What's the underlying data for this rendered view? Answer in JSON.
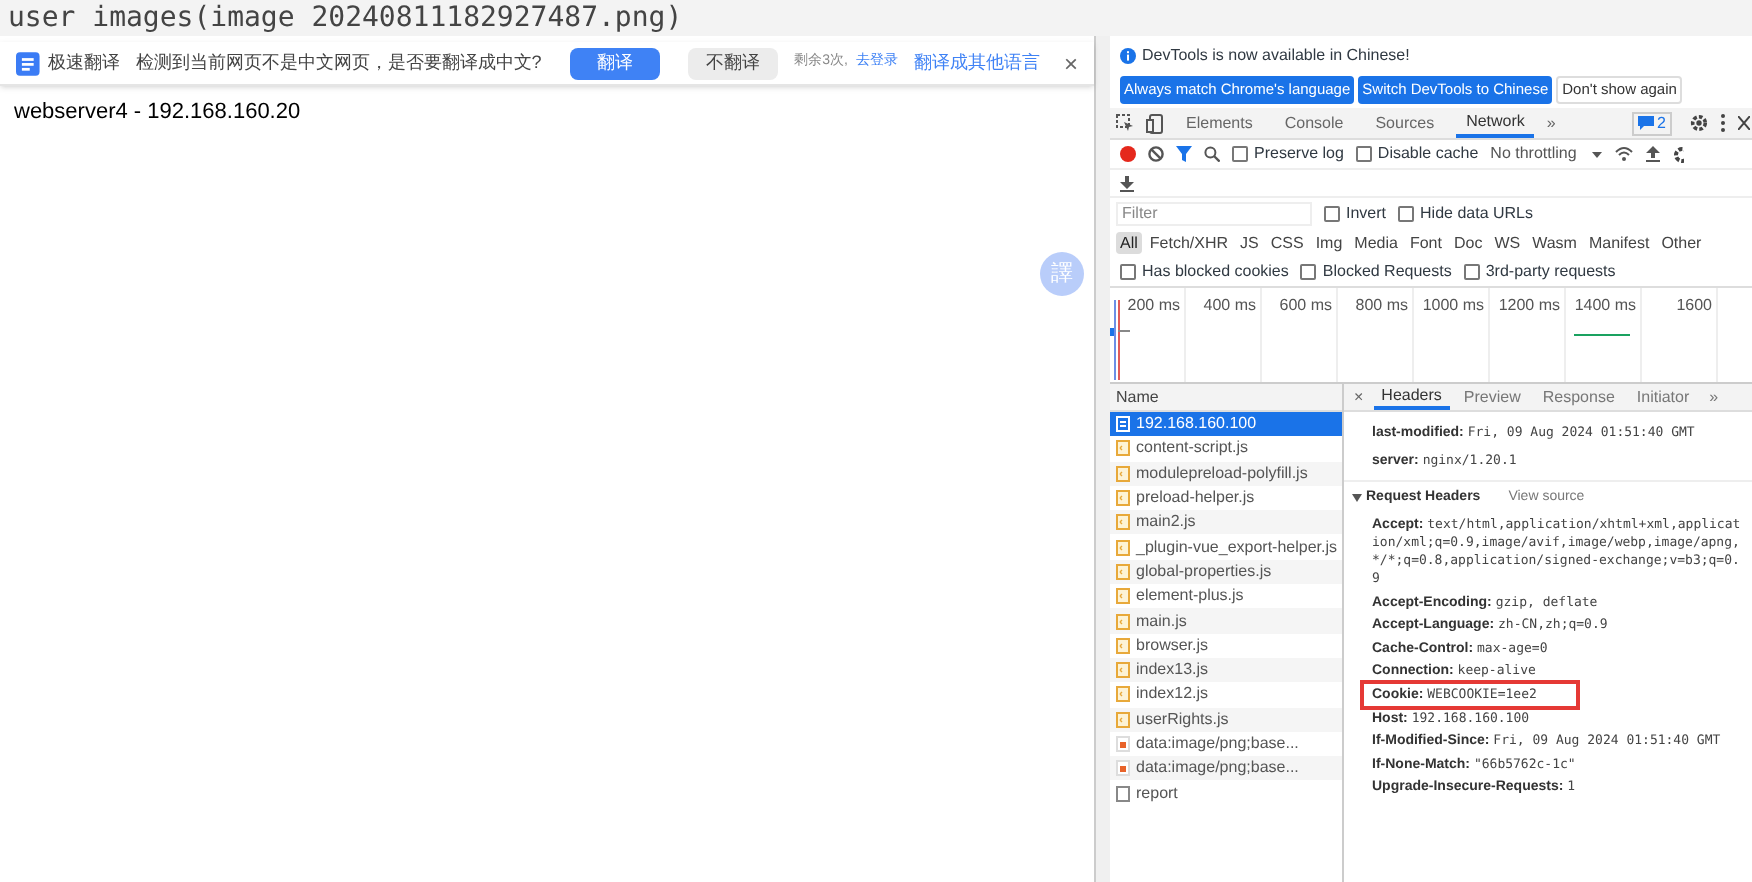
{
  "caption": "user images(image 20240811182927487.png)",
  "translate_bar": {
    "brand": "极速翻译",
    "message": "检测到当前网页不是中文网页，是否要翻译成中文?",
    "buttons": [
      {
        "label": "翻译",
        "primary": true
      },
      {
        "label": "不翻译",
        "primary": false
      }
    ],
    "remaining": "剩余3次,",
    "login": "去登录",
    "other_languages": "翻译成其他语言",
    "close": "×"
  },
  "page": {
    "text": "webserver4 - 192.168.160.20",
    "float_button": "譯"
  },
  "devtools": {
    "notice": {
      "message": "DevTools is now available in Chinese!",
      "buttons": [
        {
          "label": "Always match Chrome's language",
          "primary": true
        },
        {
          "label": "Switch DevTools to Chinese",
          "primary": true
        },
        {
          "label": "Don't show again",
          "primary": false
        }
      ]
    },
    "tabs": [
      {
        "label": "Elements",
        "selected": false
      },
      {
        "label": "Console",
        "selected": false
      },
      {
        "label": "Sources",
        "selected": false
      },
      {
        "label": "Network",
        "selected": true
      }
    ],
    "more_tabs": "»",
    "issues_count": "2",
    "toolbar": {
      "preserve_log": {
        "label": "Preserve log",
        "checked": false
      },
      "disable_cache": {
        "label": "Disable cache",
        "checked": false
      },
      "throttling": "No throttling"
    },
    "filter": {
      "placeholder": "Filter",
      "invert": {
        "label": "Invert",
        "checked": false
      },
      "hide_data_urls": {
        "label": "Hide data URLs",
        "checked": false
      }
    },
    "types": [
      {
        "label": "All",
        "selected": true
      },
      {
        "label": "Fetch/XHR",
        "selected": false
      },
      {
        "label": "JS",
        "selected": false
      },
      {
        "label": "CSS",
        "selected": false
      },
      {
        "label": "Img",
        "selected": false
      },
      {
        "label": "Media",
        "selected": false
      },
      {
        "label": "Font",
        "selected": false
      },
      {
        "label": "Doc",
        "selected": false
      },
      {
        "label": "WS",
        "selected": false
      },
      {
        "label": "Wasm",
        "selected": false
      },
      {
        "label": "Manifest",
        "selected": false
      },
      {
        "label": "Other",
        "selected": false
      }
    ],
    "blocked": [
      {
        "label": "Has blocked cookies",
        "checked": false
      },
      {
        "label": "Blocked Requests",
        "checked": false
      },
      {
        "label": "3rd-party requests",
        "checked": false
      }
    ],
    "timeline_ticks": [
      "200 ms",
      "400 ms",
      "600 ms",
      "800 ms",
      "1000 ms",
      "1200 ms",
      "1400 ms",
      "1600"
    ],
    "requests": {
      "header": "Name",
      "rows": [
        {
          "name": "192.168.160.100",
          "kind": "doc",
          "selected": true
        },
        {
          "name": "content-script.js",
          "kind": "script",
          "selected": false
        },
        {
          "name": "modulepreload-polyfill.js",
          "kind": "script",
          "selected": false
        },
        {
          "name": "preload-helper.js",
          "kind": "script",
          "selected": false
        },
        {
          "name": "main2.js",
          "kind": "script",
          "selected": false
        },
        {
          "name": "_plugin-vue_export-helper.js",
          "kind": "script",
          "selected": false
        },
        {
          "name": "global-properties.js",
          "kind": "script",
          "selected": false
        },
        {
          "name": "element-plus.js",
          "kind": "script",
          "selected": false
        },
        {
          "name": "main.js",
          "kind": "script",
          "selected": false
        },
        {
          "name": "browser.js",
          "kind": "script",
          "selected": false
        },
        {
          "name": "index13.js",
          "kind": "script",
          "selected": false
        },
        {
          "name": "index12.js",
          "kind": "script",
          "selected": false
        },
        {
          "name": "userRights.js",
          "kind": "script",
          "selected": false
        },
        {
          "name": "data:image/png;base...",
          "kind": "image",
          "selected": false
        },
        {
          "name": "data:image/png;base...",
          "kind": "image",
          "selected": false
        },
        {
          "name": "report",
          "kind": "other",
          "selected": false
        }
      ]
    },
    "detail": {
      "close": "×",
      "tabs": [
        {
          "label": "Headers",
          "selected": true
        },
        {
          "label": "Preview",
          "selected": false
        },
        {
          "label": "Response",
          "selected": false
        },
        {
          "label": "Initiator",
          "selected": false
        }
      ],
      "more_tabs": "»",
      "response_headers": [
        {
          "name": "last-modified:",
          "value": "Fri, 09 Aug 2024 01:51:40 GMT",
          "highlighted": false
        },
        {
          "name": "server:",
          "value": "nginx/1.20.1",
          "highlighted": false
        }
      ],
      "request_section": {
        "title": "Request Headers",
        "view_source": "View source",
        "expanded": true
      },
      "request_headers": [
        {
          "name": "Accept:",
          "value": "text/html,application/xhtml+xml,application/xml;q=0.9,image/avif,image/webp,image/apng,*/*;q=0.8,application/signed-exchange;v=b3;q=0.9",
          "highlighted": false
        },
        {
          "name": "Accept-Encoding:",
          "value": "gzip, deflate",
          "highlighted": false
        },
        {
          "name": "Accept-Language:",
          "value": "zh-CN,zh;q=0.9",
          "highlighted": false
        },
        {
          "name": "Cache-Control:",
          "value": "max-age=0",
          "highlighted": false
        },
        {
          "name": "Connection:",
          "value": "keep-alive",
          "highlighted": false
        },
        {
          "name": "Cookie:",
          "value": "WEBCOOKIE=1ee2",
          "highlighted": true
        },
        {
          "name": "Host:",
          "value": "192.168.160.100",
          "highlighted": false
        },
        {
          "name": "If-Modified-Since:",
          "value": "Fri, 09 Aug 2024 01:51:40 GMT",
          "highlighted": false
        },
        {
          "name": "If-None-Match:",
          "value": "\"66b5762c-1c\"",
          "highlighted": false
        },
        {
          "name": "Upgrade-Insecure-Requests:",
          "value": "1",
          "highlighted": false
        }
      ]
    }
  }
}
